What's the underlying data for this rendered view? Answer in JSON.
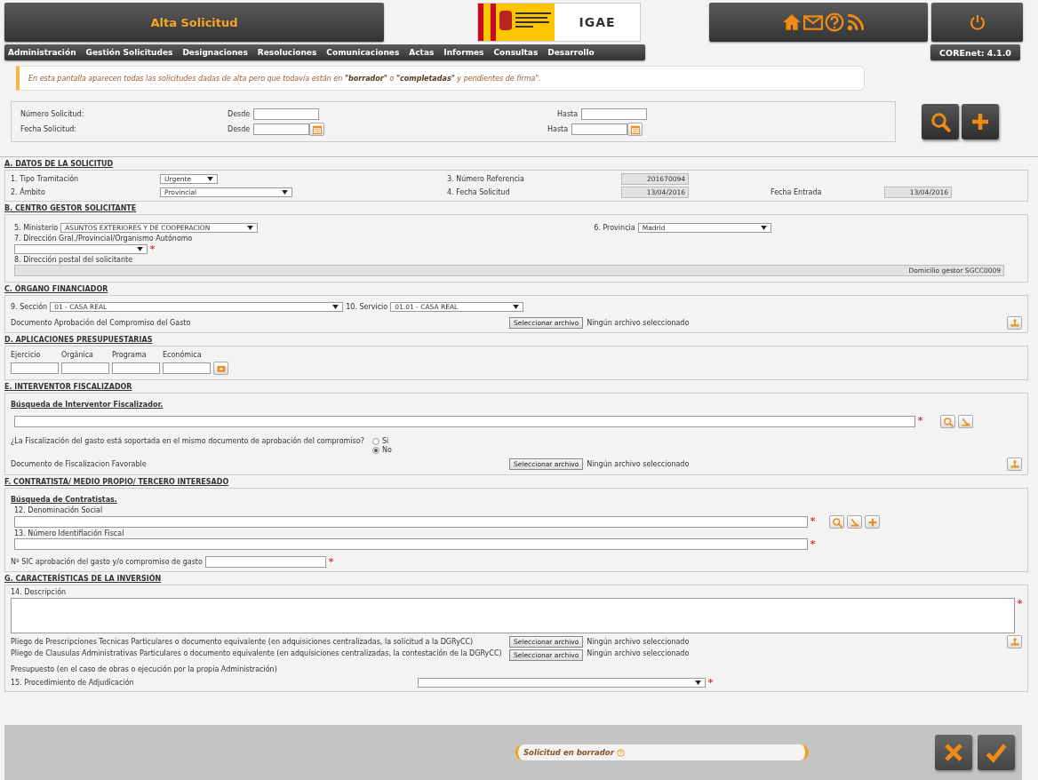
{
  "header": {
    "title": "Alta Solicitud",
    "logo": {
      "igae": "IGAE"
    }
  },
  "menu": {
    "items": [
      "Administración",
      "Gestión Solicitudes",
      "Designaciones",
      "Resoluciones",
      "Comunicaciones",
      "Actas",
      "Informes",
      "Consultas",
      "Desarrollo"
    ],
    "version": "COREnet: 4.1.0"
  },
  "notice": "En esta pantalla aparecen todas las solicitudes dadas de alta pero que todavía están en **\"borrador\"** o **\"completadas\"** y pendientes de firma\".",
  "filter": {
    "rows": [
      {
        "label": "Número Solicitud:",
        "from_label": "Desde",
        "to_label": "Hasta",
        "kind": "number"
      },
      {
        "label": "Fecha Solicitud:",
        "from_label": "Desde",
        "to_label": "Hasta",
        "kind": "date"
      }
    ]
  },
  "sections": [
    {
      "title": "A. DATOS DE LA SOLICITUD",
      "fields": [
        {
          "label": "1. Tipo Tramitación",
          "kind": "select",
          "value": "Urgente",
          "required": false
        },
        {
          "label": "2. Ámbito",
          "kind": "select",
          "value": "Provincial",
          "required": false
        },
        {
          "label": "3. Número Referencia",
          "kind": "readonly",
          "value": "201670094",
          "required": false
        },
        {
          "label": "4. Fecha Solicitud",
          "kind": "readonly",
          "value": "13/04/2016",
          "required": false
        },
        {
          "label": "Fecha Entrada",
          "kind": "readonly",
          "value": "13/04/2016",
          "required": false
        }
      ]
    },
    {
      "title": "B. CENTRO GESTOR SOLICITANTE",
      "fields": [
        {
          "label": "5. Ministerio",
          "kind": "select",
          "value": "ASUNTOS EXTERIORES Y DE COOPERACION",
          "required": false
        },
        {
          "label": "6. Provincia",
          "kind": "select",
          "value": "Madrid",
          "required": false
        },
        {
          "label": "7. Dirección Gral./Provincial/Organismo Autónomo",
          "kind": "select",
          "required": true
        },
        {
          "label": "8. Dirección postal del solicitante",
          "kind": "readonly",
          "value": "Domicilio gestor SGCC0009",
          "required": false
        }
      ]
    },
    {
      "title": "C. ÓRGANO FINANCIADOR",
      "fields": [
        {
          "label": "9. Sección",
          "kind": "select",
          "value": "01 - CASA REAL",
          "required": false
        },
        {
          "label": "10. Servicio",
          "kind": "select",
          "value": "01.01 - CASA REAL",
          "required": false
        }
      ],
      "files": [
        {
          "label": "Documento Aprobación del Compromiso del Gasto",
          "button": "Seleccionar archivo",
          "status": "Ningún archivo seleccionado"
        }
      ]
    },
    {
      "title": "D. APLICACIONES PRESUPUESTARIAS",
      "fields": [
        {
          "label": "Ejercicio",
          "kind": "input",
          "required": false
        },
        {
          "label": "Orgánica",
          "kind": "input",
          "required": false
        },
        {
          "label": "Programa",
          "kind": "input",
          "required": false
        },
        {
          "label": "Económica",
          "kind": "input",
          "required": false
        }
      ]
    },
    {
      "title": "E. INTERVENTOR FISCALIZADOR",
      "subtitle": "Búsqueda de Interventor Fiscalizador.",
      "fields": [
        {
          "kind": "input",
          "required": true
        }
      ],
      "question": "¿La Fiscalización del gasto está soportada en el mismo documento de aprobación del compromiso?",
      "options": [
        {
          "label": "Si",
          "selected": false
        },
        {
          "label": "No",
          "selected": true
        }
      ],
      "files": [
        {
          "label": "Documento de Fiscalizacion Favorable",
          "button": "Seleccionar archivo",
          "status": "Ningún archivo seleccionado"
        }
      ]
    },
    {
      "title": "F. CONTRATISTA/ MEDIO PROPIO/ TERCERO INTERESADO",
      "subtitle": "Búsqueda de Contratistas.",
      "fields": [
        {
          "label": "12. Denominación Social",
          "kind": "input",
          "required": true
        },
        {
          "label": "13. Número Identifiación Fiscal",
          "kind": "input",
          "required": true
        },
        {
          "label": "Nº SIC aprobación del gasto y/o compromiso de gasto",
          "kind": "input",
          "required": true
        }
      ]
    },
    {
      "title": "G. CARACTERÍSTICAS DE LA INVERSIÓN",
      "fields": [
        {
          "label": "14. Descripción",
          "kind": "textarea",
          "required": true
        },
        {
          "label": "15. Procedimiento de Adjudicación",
          "kind": "select",
          "required": true
        }
      ],
      "files": [
        {
          "label": "Pliego de Prescripciones Tecnicas Particulares o documento equivalente (en adquisiciones centralizadas, la solicitud a la DGRyCC)",
          "button": "Seleccionar archivo",
          "status": "Ningún archivo seleccionado"
        },
        {
          "label": "Pliego de Clausulas Administrativas Particulares o documento equivalente (en adquisiciones centralizadas, la contestación de la DGRyCC)",
          "button": "Seleccionar archivo",
          "status": "Ningún archivo seleccionado"
        },
        {
          "label": "Presupuesto (en el caso de obras o ejecución por la propia Administración)"
        }
      ]
    }
  ],
  "footer": {
    "status": "Solicitud en borrador"
  }
}
